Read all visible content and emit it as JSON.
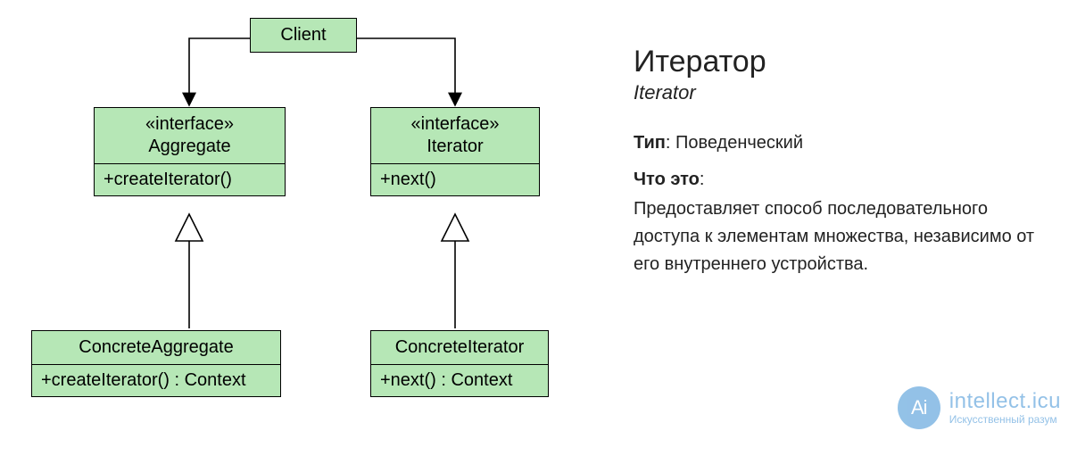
{
  "diagram": {
    "client": {
      "title": "Client"
    },
    "aggregate_interface": {
      "stereotype": "«interface»",
      "name": "Aggregate",
      "method": "+createIterator()"
    },
    "iterator_interface": {
      "stereotype": "«interface»",
      "name": "Iterator",
      "method": "+next()"
    },
    "concrete_aggregate": {
      "name": "ConcreteAggregate",
      "method": "+createIterator() : Context"
    },
    "concrete_iterator": {
      "name": "ConcreteIterator",
      "method": "+next() : Context"
    }
  },
  "text": {
    "title": "Итератор",
    "subtitle": "Iterator",
    "type_label": "Тип",
    "type_value": ": Поведенческий",
    "what_label": "Что это",
    "what_colon": ":",
    "description": "Предоставляет способ последова­тельного доступа к элементам множества, независимо от его внутреннего устройства."
  },
  "watermark": {
    "badge": "Ai",
    "main": "intellect.icu",
    "sub": "Искусственный разум"
  }
}
